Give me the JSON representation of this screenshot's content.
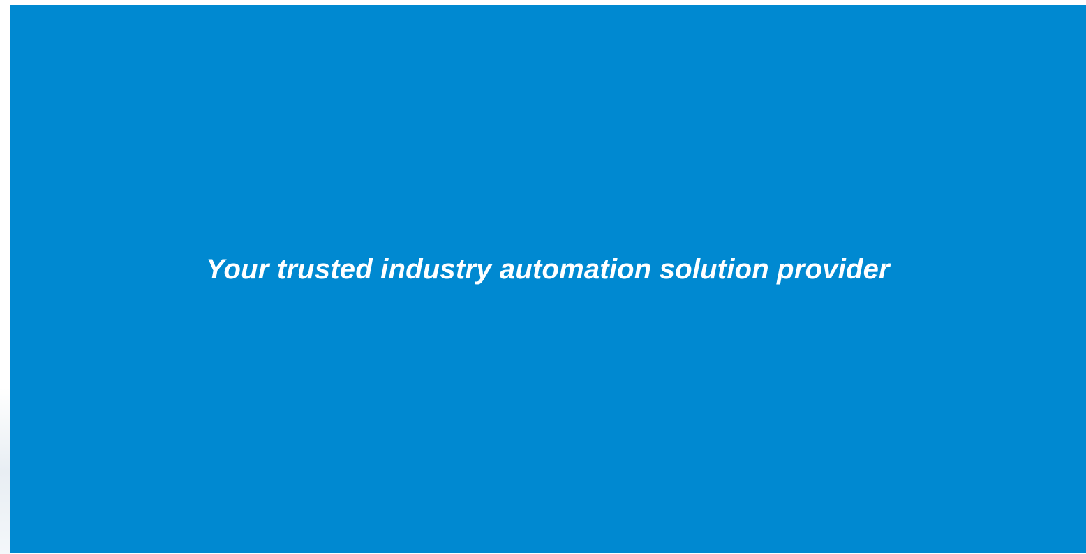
{
  "hero": {
    "tagline": "Your trusted industry automation solution provider",
    "background_color": "#0089d1",
    "text_color": "#ffffff"
  }
}
